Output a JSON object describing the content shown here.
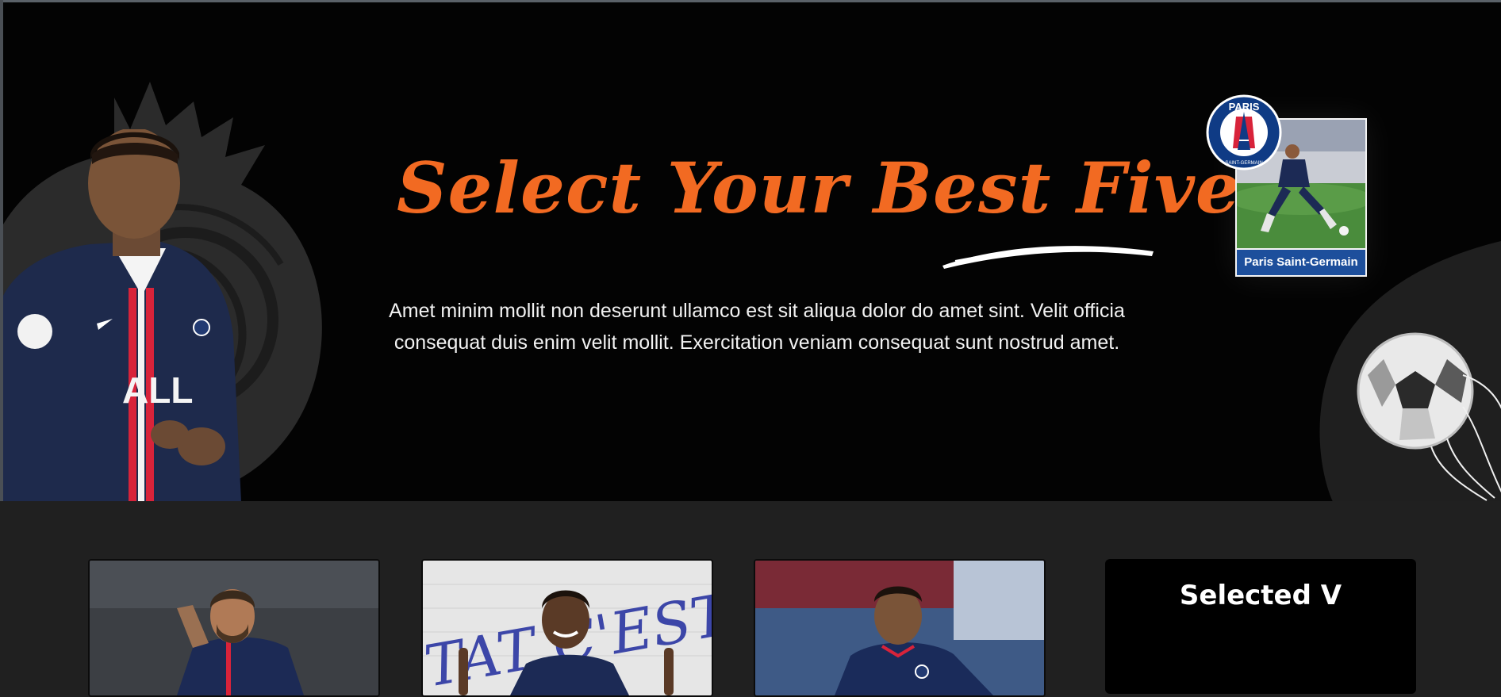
{
  "hero": {
    "title": "Select Your Best Five",
    "description": "Amet minim mollit non deserunt ullamco est sit aliqua dolor do amet sint. Velit officia consequat duis enim velit mollit. Exercitation veniam consequat sunt nostrud amet.",
    "club_card_label": "Paris Saint-Germain",
    "crest_text_top": "PARIS",
    "crest_text_bottom": "SAINT-GERMAIN",
    "colors": {
      "accent": "#f26a22",
      "background": "#030303",
      "section_bg": "#202020"
    }
  },
  "players": [
    {
      "icon": "player-photo"
    },
    {
      "icon": "player-photo",
      "wall_text": "TAT C'EST"
    },
    {
      "icon": "player-photo"
    }
  ],
  "selected": {
    "title": "Selected V"
  },
  "icons": [
    "lion-crest-icon",
    "soccer-ball-icon",
    "psg-crest-icon",
    "underline-swoosh-icon"
  ]
}
